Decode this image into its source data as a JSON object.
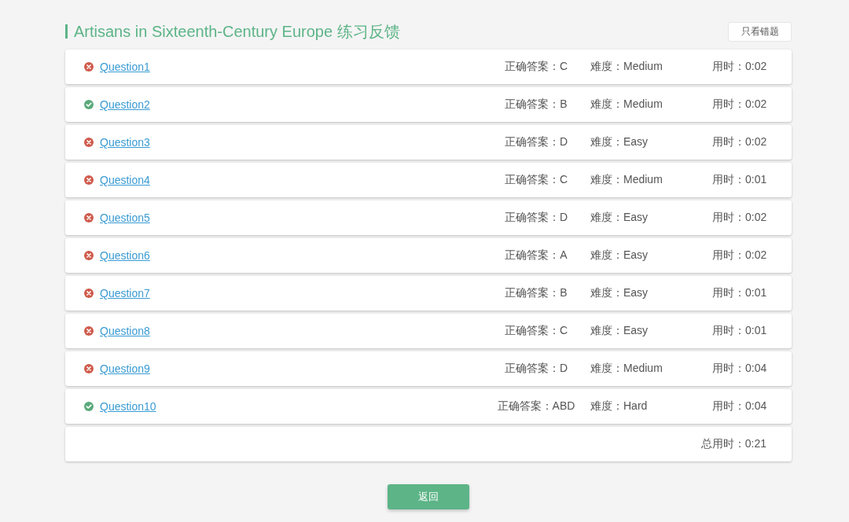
{
  "title": "Artisans in Sixteenth-Century Europe 练习反馈",
  "filter_button": {
    "label": "只看错题"
  },
  "questions": [
    {
      "label": "Question1",
      "correct": false,
      "answer": "正确答案：C",
      "difficulty": "难度：Medium",
      "time": "用时：0:02"
    },
    {
      "label": "Question2",
      "correct": true,
      "answer": "正确答案：B",
      "difficulty": "难度：Medium",
      "time": "用时：0:02"
    },
    {
      "label": "Question3",
      "correct": false,
      "answer": "正确答案：D",
      "difficulty": "难度：Easy",
      "time": "用时：0:02"
    },
    {
      "label": "Question4",
      "correct": false,
      "answer": "正确答案：C",
      "difficulty": "难度：Medium",
      "time": "用时：0:01"
    },
    {
      "label": "Question5",
      "correct": false,
      "answer": "正确答案：D",
      "difficulty": "难度：Easy",
      "time": "用时：0:02"
    },
    {
      "label": "Question6",
      "correct": false,
      "answer": "正确答案：A",
      "difficulty": "难度：Easy",
      "time": "用时：0:02"
    },
    {
      "label": "Question7",
      "correct": false,
      "answer": "正确答案：B",
      "difficulty": "难度：Easy",
      "time": "用时：0:01"
    },
    {
      "label": "Question8",
      "correct": false,
      "answer": "正确答案：C",
      "difficulty": "难度：Easy",
      "time": "用时：0:01"
    },
    {
      "label": "Question9",
      "correct": false,
      "answer": "正确答案：D",
      "difficulty": "难度：Medium",
      "time": "用时：0:04"
    },
    {
      "label": "Question10",
      "correct": true,
      "answer": "正确答案：ABD",
      "difficulty": "难度：Hard",
      "time": "用时：0:04"
    }
  ],
  "total": "总用时：0:21",
  "back_button": {
    "label": "返回"
  }
}
